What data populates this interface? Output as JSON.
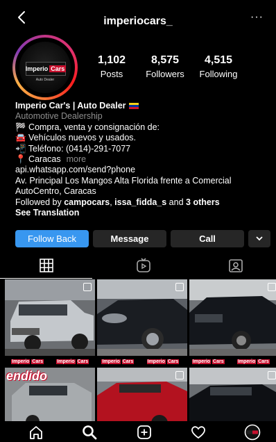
{
  "header": {
    "username": "imperiocars_",
    "more_label": "···"
  },
  "avatar": {
    "logo_word1": "Imperio",
    "logo_word2": "Cars",
    "logo_sub": "Auto Dealer"
  },
  "stats": [
    {
      "value": "1,102",
      "label": "Posts"
    },
    {
      "value": "8,575",
      "label": "Followers"
    },
    {
      "value": "4,515",
      "label": "Following"
    }
  ],
  "bio": {
    "name": "Imperio Car's | Auto Dealer",
    "category": "Automotive Dealership",
    "line1": "🏁 Compra, venta y consignación de:",
    "line2": "🚘 Vehículos nuevos y usados.",
    "line3": "📲 Teléfono: (0414)-291-7077",
    "line4": "📍 Caracas",
    "more": "more",
    "link": "api.whatsapp.com/send?phone",
    "address1": "Av. Principal Los Mangos Alta Florida frente a Comercial",
    "address2": "AutoCentro, Caracas",
    "followed_prefix": "Followed by ",
    "followed_user1": "campocars",
    "followed_sep": ", ",
    "followed_user2": "issa_fidda_s",
    "followed_and": " and ",
    "followed_others": "3 others",
    "translation": "See Translation"
  },
  "actions": {
    "follow_back": "Follow Back",
    "message": "Message",
    "call": "Call"
  },
  "grid": {
    "strip_word1": "Imperio",
    "strip_word2": "Cars",
    "overlay_text": "endido"
  },
  "icons": {
    "back": "chevron-left-icon",
    "grid_tab": "grid-icon",
    "reels_tab": "reels-icon",
    "tagged_tab": "tagged-icon",
    "home": "home-icon",
    "search": "search-icon",
    "new_post": "add-post-icon",
    "activity": "heart-icon",
    "profile": "profile-avatar"
  },
  "colors": {
    "background": "#000000",
    "primary_button": "#3897f0",
    "secondary_button": "#262626",
    "brand_red": "#c8102e"
  }
}
